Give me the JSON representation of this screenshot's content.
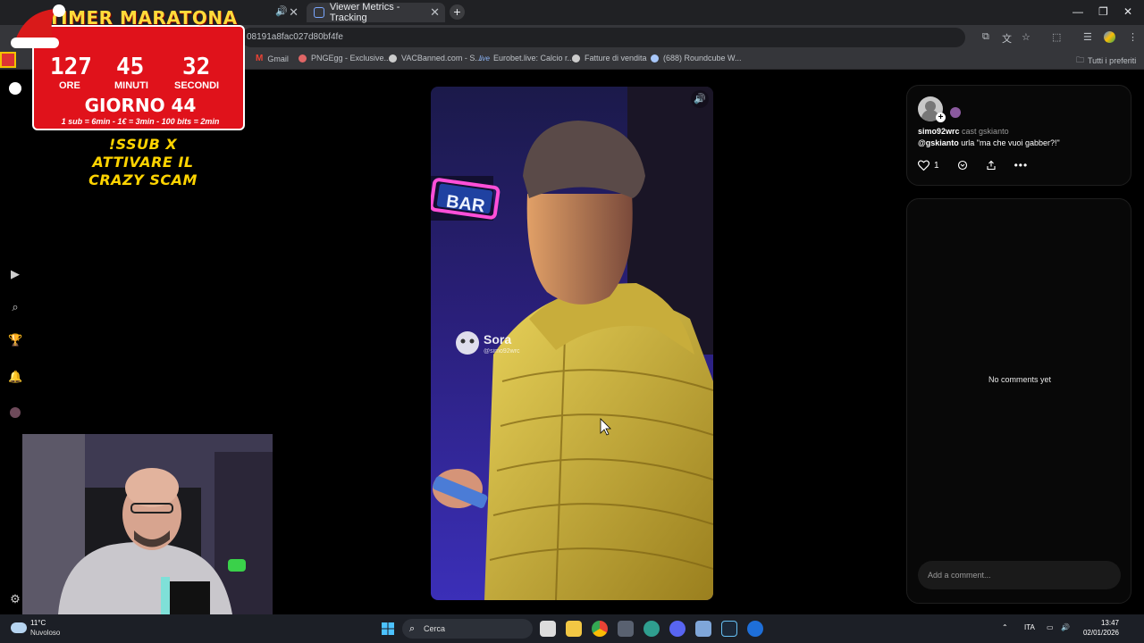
{
  "browser": {
    "tabs": [
      {
        "label": "Viewer Metrics - Tracking",
        "active": true
      }
    ],
    "url_fragment": "08191a8fac027d80bf4fe",
    "bookmarks": [
      {
        "label": "Gmail",
        "icon": "gmail-icon"
      },
      {
        "label": "PNGEgg - Exclusive...",
        "icon": "globe-icon"
      },
      {
        "label": "VACBanned.com - S...",
        "icon": "globe-icon"
      },
      {
        "label": "Eurobet.live: Calcio r...",
        "icon": "eurobet-icon"
      },
      {
        "label": "Fatture di vendita",
        "icon": "globe-icon"
      },
      {
        "label": "(688) Roundcube W...",
        "icon": "roundcube-icon"
      }
    ],
    "all_bookmarks_label": "Tutti i preferiti"
  },
  "timer": {
    "title": "TIMER MARATONA",
    "hours": "127",
    "minutes": "45",
    "seconds": "32",
    "hours_label": "ORE",
    "minutes_label": "MINUTI",
    "seconds_label": "SECONDI",
    "day": "GIORNO 44",
    "rules": "1 sub = 6min - 1€ = 3min - 100 bits = 2min",
    "accent_color": "#e0121b",
    "title_color": "#ffdb3a"
  },
  "promo": {
    "line1": "!SSUB X",
    "line2": "ATTIVARE IL",
    "line3": "CRAZY SCAM",
    "color": "#ffd400"
  },
  "video": {
    "sign_text": "BAR",
    "watermark_brand": "Sora",
    "watermark_handle": "@simo92wrc"
  },
  "post": {
    "author": "simo92wrc",
    "cast_label": "cast gskianto",
    "caption_mention": "@gskianto",
    "caption_text": " urla \"ma che vuoi gabber?!\"",
    "likes": "1"
  },
  "comments": {
    "empty_text": "No comments yet",
    "input_placeholder": "Add a comment..."
  },
  "taskbar": {
    "temperature": "11°C",
    "weather": "Nuvoloso",
    "search_label": "Cerca",
    "language": "ITA",
    "time": "13:47",
    "date": "02/01/2026"
  }
}
